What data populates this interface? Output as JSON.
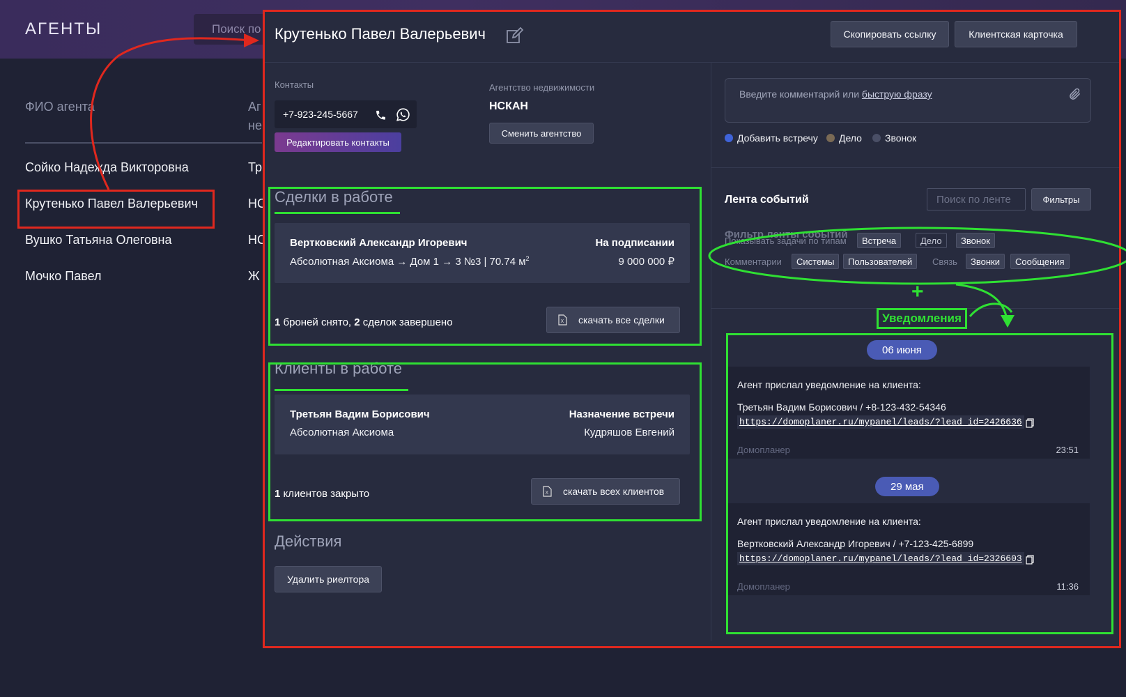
{
  "app": {
    "title": "АГЕНТЫ",
    "search_placeholder": "Поиск по"
  },
  "list": {
    "col_fio": "ФИО агента",
    "col_agency": "Аг не",
    "agents": [
      {
        "name": "Сойко Надежда Викторовна",
        "agency": "Тр"
      },
      {
        "name": "Крутенько Павел Валерьевич",
        "agency": "НС"
      },
      {
        "name": "Вушко Татьяна Олеговна",
        "agency": "НС"
      },
      {
        "name": "Мочко Павел",
        "agency": "Ж"
      }
    ]
  },
  "panel": {
    "agent_name": "Крутенько Павел Валерьевич",
    "copy_link": "Скопировать ссылку",
    "client_card": "Клиентская карточка",
    "contacts_label": "Контакты",
    "phone": "+7-923-245-5667",
    "edit_contacts": "Редактировать контакты",
    "agency_label": "Агентство недвижимости",
    "agency_name": "НСКАН",
    "change_agency": "Сменить агентство",
    "deals": {
      "title": "Сделки в работе",
      "client": "Вертковский Александр Игоревич",
      "status": "На подписании",
      "object": "Абсолютная Аксиома → Дом 1 → 3 №3 | 70.74 м",
      "object_sup": "2",
      "price": "9 000 000 ₽",
      "summary_n1": "1",
      "summary_t1": " броней снято, ",
      "summary_n2": "2",
      "summary_t2": " сделок завершено",
      "download": "скачать все сделки"
    },
    "clients": {
      "title": "Клиенты в работе",
      "client": "Третьян Вадим Борисович",
      "status": "Назначение встречи",
      "object": "Абсолютная Аксиома",
      "manager": "Кудряшов Евгений",
      "summary_n1": "1",
      "summary_t1": " клиентов закрыто",
      "download": "скачать всех клиентов"
    },
    "actions": {
      "title": "Действия",
      "delete": "Удалить риелтора"
    },
    "comment": {
      "placeholder": "Введите комментарий или ",
      "quick_phrase": "быструю фразу"
    },
    "radios": [
      {
        "label": "Добавить встречу",
        "color": "#3f63d9"
      },
      {
        "label": "Дело",
        "color": "#7a6a55"
      },
      {
        "label": "Звонок",
        "color": "#4a4f66"
      }
    ],
    "feed": {
      "title": "Лента событий",
      "search_placeholder": "Поиск по ленте",
      "filters_btn": "Фильтры",
      "filter_title": "Фильтр ленты событий",
      "show_tasks_label": "Показывать задачи по типам",
      "task_chips": [
        "Встреча",
        "Дело",
        "Звонок"
      ],
      "comments_label": "Комментарии",
      "comment_chips": [
        "Системы",
        "Пользователей"
      ],
      "link_label": "Связь",
      "link_chips": [
        "Звонки",
        "Сообщения"
      ],
      "annotation_plus": "+",
      "annotation_label": "Уведомления"
    },
    "notifications": [
      {
        "date": "06 июня",
        "title": "Агент прислал уведомление на клиента:",
        "client": "Третьян Вадим Борисович / +8-123-432-54346",
        "link": "https://domoplaner.ru/mypanel/leads/?lead_id=2426636",
        "source": "Домопланер",
        "time": "23:51"
      },
      {
        "date": "29 мая",
        "title": "Агент прислал уведомление на клиента:",
        "client": "Вертковский Александр Игоревич / +7-123-425-6899",
        "link": "https://domoplaner.ru/mypanel/leads/?lead_id=2326603",
        "source": "Домопланер",
        "time": "11:36"
      }
    ]
  },
  "colors": {
    "annotation_red": "#e0281e",
    "annotation_green": "#2fe033",
    "accent_blue": "#4a5bb5",
    "edit_contacts_gradient": "#7b3a8f"
  }
}
